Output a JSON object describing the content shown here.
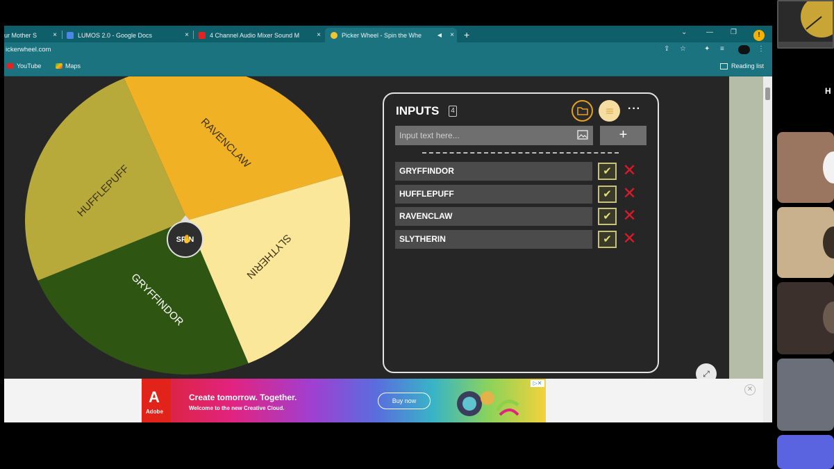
{
  "browser": {
    "tabs": [
      {
        "label": "ur Mother S",
        "close": "×"
      },
      {
        "label": "LUMOS 2.0 - Google Docs",
        "close": "×"
      },
      {
        "label": "4 Channel Audio Mixer Sound M",
        "close": "×"
      },
      {
        "label": "Picker Wheel - Spin the Whe",
        "close": "×"
      }
    ],
    "new_tab": "+",
    "url": "ickerwheel.com",
    "profile_badge": "!",
    "bookmarks": [
      {
        "label": "YouTube"
      },
      {
        "label": "Maps"
      }
    ],
    "reading_list": "Reading list"
  },
  "wheel": {
    "segments": [
      {
        "label": "RAVENCLAW",
        "color": "#f0b124"
      },
      {
        "label": "SLYTHERIN",
        "color": "#fbe79a"
      },
      {
        "label": "GRYFFINDOR",
        "color": "#2e5512"
      },
      {
        "label": "HUFFLEPUFF",
        "color": "#b8aa3a"
      }
    ],
    "spin_label": "SPIN"
  },
  "inputs_panel": {
    "title": "INPUTS",
    "count": "4",
    "placeholder": "Input text here...",
    "add_label": "+",
    "more_label": "···",
    "entries": [
      {
        "label": "GRYFFINDOR",
        "checked": true
      },
      {
        "label": "HUFFLEPUFF",
        "checked": true
      },
      {
        "label": "RAVENCLAW",
        "checked": true
      },
      {
        "label": "SLYTHERIN",
        "checked": true
      }
    ]
  },
  "ad": {
    "logo_text": "Adobe",
    "headline": "Create tomorrow. Together.",
    "subline": "Welcome to the new Creative Cloud.",
    "button": "Buy now"
  },
  "side_panel": {
    "top_text": "H"
  },
  "colors": {
    "accent_teal": "#1b7380",
    "tab_bar": "#0f5f6a",
    "delete_red": "#e0192a",
    "check_yellow": "#e3dc77"
  }
}
